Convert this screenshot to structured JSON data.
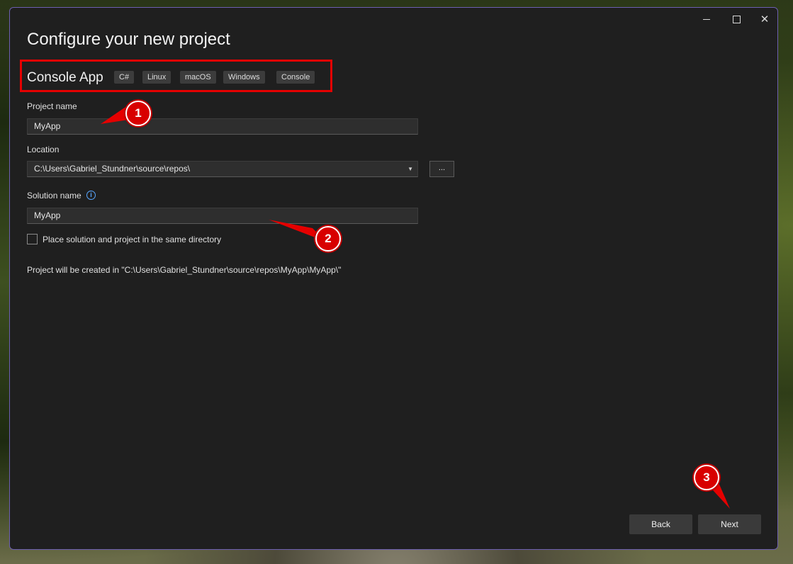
{
  "window": {
    "title": "Configure your new project",
    "controls": {
      "minimize_icon": "minimize-icon",
      "maximize_icon": "maximize-icon",
      "close_icon": "close-icon",
      "close_glyph": "✕"
    }
  },
  "template": {
    "name": "Console App",
    "tags": [
      "C#",
      "Linux",
      "macOS",
      "Windows",
      "Console"
    ]
  },
  "project_name": {
    "label": "Project name",
    "value": "MyApp"
  },
  "location": {
    "label": "Location",
    "value": "C:\\Users\\Gabriel_Stundner\\source\\repos\\",
    "dropdown_glyph": "▼",
    "browse_label": "..."
  },
  "solution_name": {
    "label": "Solution name",
    "value": "MyApp",
    "info_glyph": "i"
  },
  "same_directory": {
    "label": "Place solution and project in the same directory",
    "checked": false
  },
  "created_path": "Project will be created in \"C:\\Users\\Gabriel_Stundner\\source\\repos\\MyApp\\MyApp\\\"",
  "buttons": {
    "back": "Back",
    "next": "Next"
  },
  "callouts": [
    "1",
    "2",
    "3"
  ],
  "colors": {
    "highlight": "#e50000",
    "callout": "#d80000",
    "window_border": "#6d5fb0",
    "info": "#58a6ff"
  }
}
